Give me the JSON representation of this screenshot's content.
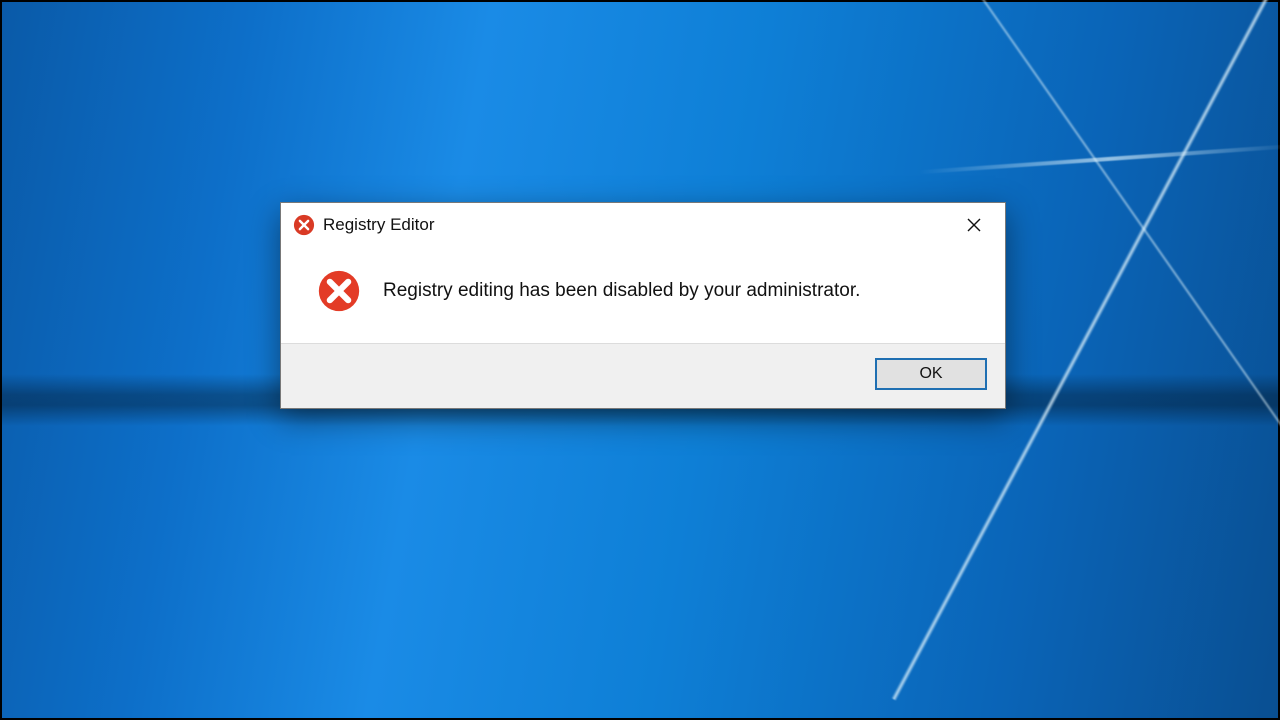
{
  "dialog": {
    "title": "Registry Editor",
    "message": "Registry editing has been disabled by your administrator.",
    "ok_label": "OK"
  },
  "icons": {
    "title_icon": "error-icon",
    "body_icon": "error-icon",
    "close_icon": "close-icon"
  },
  "colors": {
    "error": "#e33b26",
    "accent": "#1f6fb2",
    "button_face": "#e1e1e1",
    "button_panel": "#f0f0f0",
    "window_bg": "#ffffff"
  }
}
